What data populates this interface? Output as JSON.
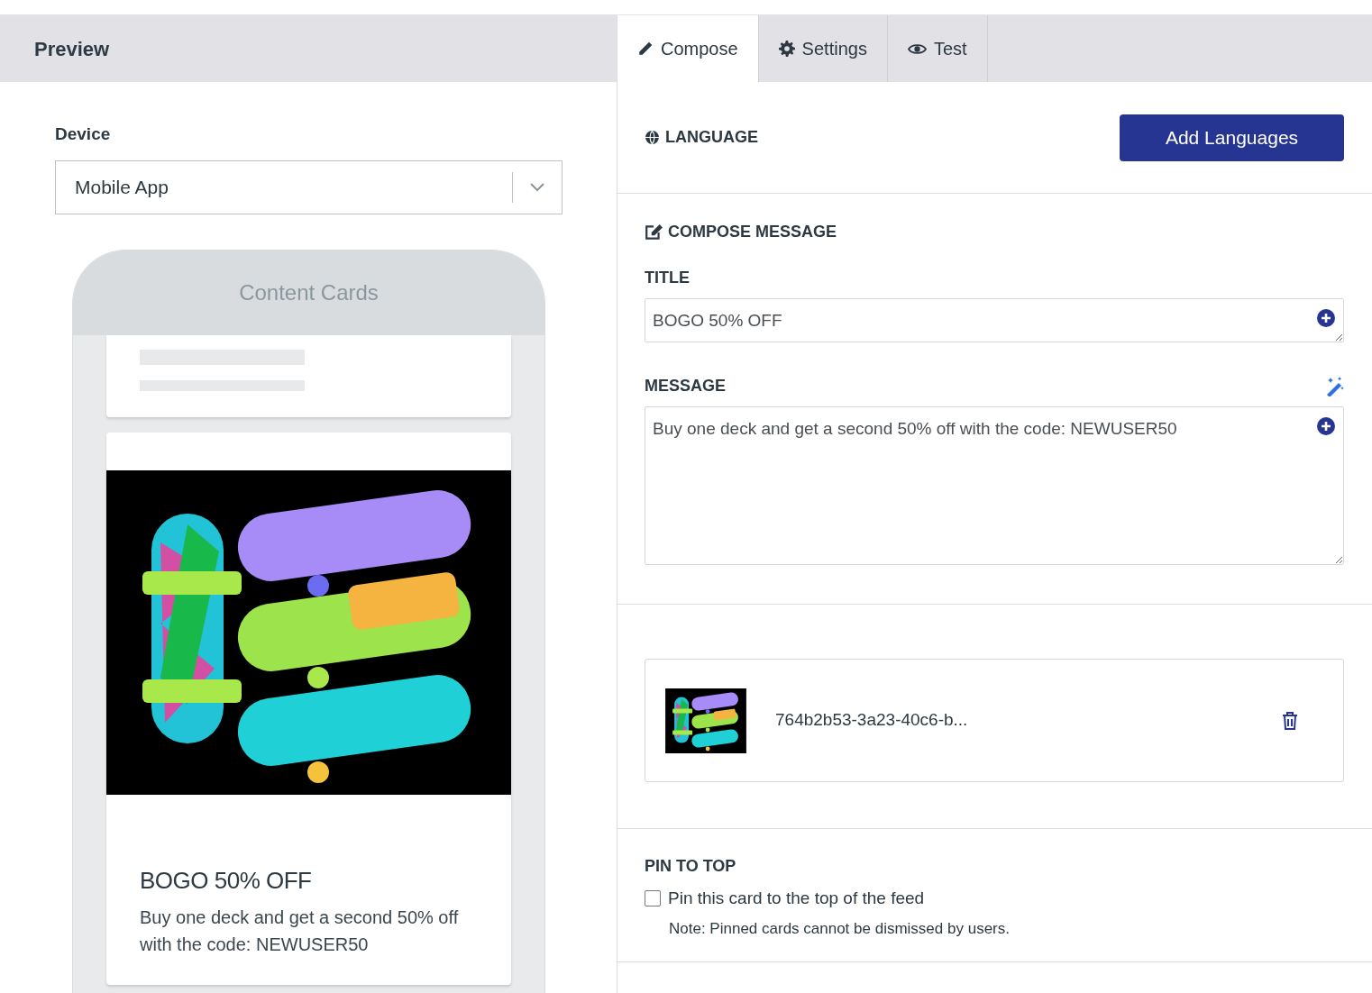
{
  "header": {
    "title": "Preview"
  },
  "tabs": [
    {
      "label": "Compose",
      "selected": true
    },
    {
      "label": "Settings",
      "selected": false
    },
    {
      "label": "Test",
      "selected": false
    }
  ],
  "device": {
    "label": "Device",
    "value": "Mobile App"
  },
  "phone": {
    "title": "Content Cards",
    "card": {
      "kind": "picture",
      "title": "BOGO 50% OFF",
      "description": "Buy one deck and get a second 50% off with the code: NEWUSER50"
    }
  },
  "language": {
    "heading": "LANGUAGE",
    "button": "Add Languages"
  },
  "compose": {
    "heading": "COMPOSE MESSAGE",
    "fields": [
      {
        "label": "TITLE",
        "value": "BOGO 50% OFF",
        "kind": "single"
      },
      {
        "label": "MESSAGE",
        "value": "Buy one deck and get a second 50% off with the code: NEWUSER50",
        "kind": "multi"
      }
    ]
  },
  "image": {
    "kind": "picture",
    "filename": "764b2b53-3a23-40c6-b..."
  },
  "pin": {
    "heading": "PIN TO TOP",
    "label": "Pin this card to the top of the feed",
    "checked": false,
    "note": "Note: Pinned cards cannot be dismissed by users."
  }
}
